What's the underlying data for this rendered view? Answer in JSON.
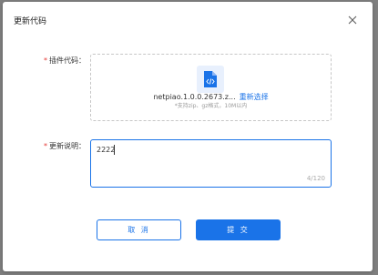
{
  "modal": {
    "title": "更新代码",
    "close_icon": "close-icon"
  },
  "form": {
    "plugin_code": {
      "label": "插件代码：",
      "file_name": "netpiao.1.0.0.2673.z...",
      "reselect_label": "重新选择",
      "hint": "*支持zip、gz格式，10M以内",
      "icon": "code-file-icon"
    },
    "description": {
      "label": "更新说明：",
      "value": "2222",
      "counter": "4/120"
    }
  },
  "buttons": {
    "cancel": "取 消",
    "submit": "提 交"
  },
  "colors": {
    "accent": "#1a73e8",
    "required": "#e53935"
  }
}
